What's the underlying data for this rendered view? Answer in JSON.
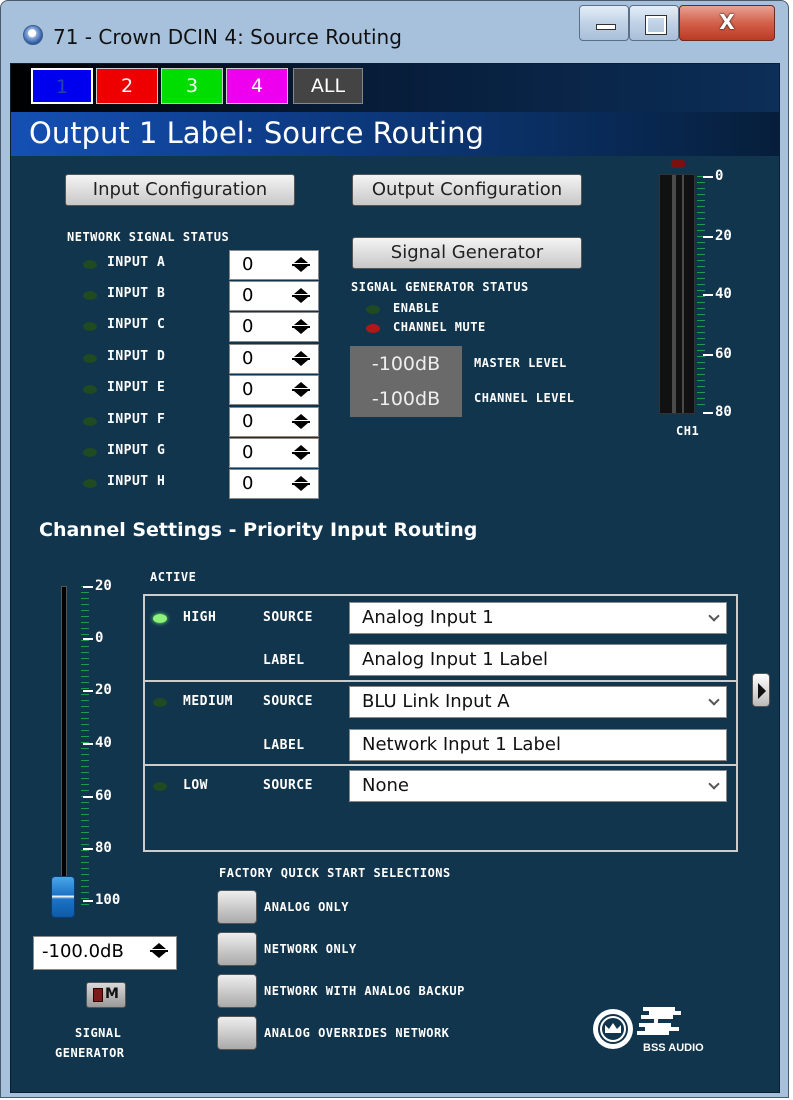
{
  "window": {
    "title": "71 - Crown DCIN 4: Source Routing",
    "close_label": "X"
  },
  "channel_tabs": [
    "1",
    "2",
    "3",
    "4",
    "ALL"
  ],
  "header": {
    "output_label": "Output 1 Label: Source Routing"
  },
  "buttons": {
    "input_config": "Input Configuration",
    "output_config": "Output Configuration",
    "signal_generator": "Signal Generator"
  },
  "network_signal_status": {
    "title": "NETWORK SIGNAL STATUS",
    "inputs": [
      {
        "label": "INPUT A",
        "value": "0"
      },
      {
        "label": "INPUT B",
        "value": "0"
      },
      {
        "label": "INPUT C",
        "value": "0"
      },
      {
        "label": "INPUT D",
        "value": "0"
      },
      {
        "label": "INPUT E",
        "value": "0"
      },
      {
        "label": "INPUT F",
        "value": "0"
      },
      {
        "label": "INPUT G",
        "value": "0"
      },
      {
        "label": "INPUT H",
        "value": "0"
      }
    ]
  },
  "signal_generator_status": {
    "title": "SIGNAL GENERATOR STATUS",
    "enable_label": "ENABLE",
    "channel_mute_label": "CHANNEL MUTE",
    "master_level_value": "-100dB",
    "master_level_label": "MASTER LEVEL",
    "channel_level_value": "-100dB",
    "channel_level_label": "CHANNEL LEVEL"
  },
  "meter": {
    "ticks": [
      "0",
      "20",
      "40",
      "60",
      "80"
    ],
    "channel_label": "CH1"
  },
  "channel_settings": {
    "title": "Channel Settings - Priority Input Routing",
    "active_label": "ACTIVE",
    "source_label": "SOURCE",
    "label_label": "LABEL",
    "priorities": [
      {
        "name": "HIGH",
        "source": "Analog Input 1",
        "label": "Analog Input 1 Label",
        "active": true
      },
      {
        "name": "MEDIUM",
        "source": "BLU Link Input A",
        "label": "Network Input 1 Label",
        "active": false
      },
      {
        "name": "LOW",
        "source": "None",
        "active": false
      }
    ]
  },
  "fader": {
    "ticks": [
      "20",
      "0",
      "20",
      "40",
      "60",
      "80",
      "100"
    ],
    "value": "-100.0dB",
    "mute_label": "M",
    "signal_generator_label": [
      "SIGNAL",
      "GENERATOR"
    ]
  },
  "quick_start": {
    "title": "FACTORY QUICK START SELECTIONS",
    "options": [
      "ANALOG ONLY",
      "NETWORK ONLY",
      "NETWORK WITH ANALOG BACKUP",
      "ANALOG OVERRIDES NETWORK"
    ]
  },
  "logo": {
    "text": "BSS AUDIO"
  },
  "colors": {
    "panel": "#12354e",
    "led_on": "#8ff27a",
    "led_off": "#1f4a22",
    "led_red": "#b01818"
  }
}
